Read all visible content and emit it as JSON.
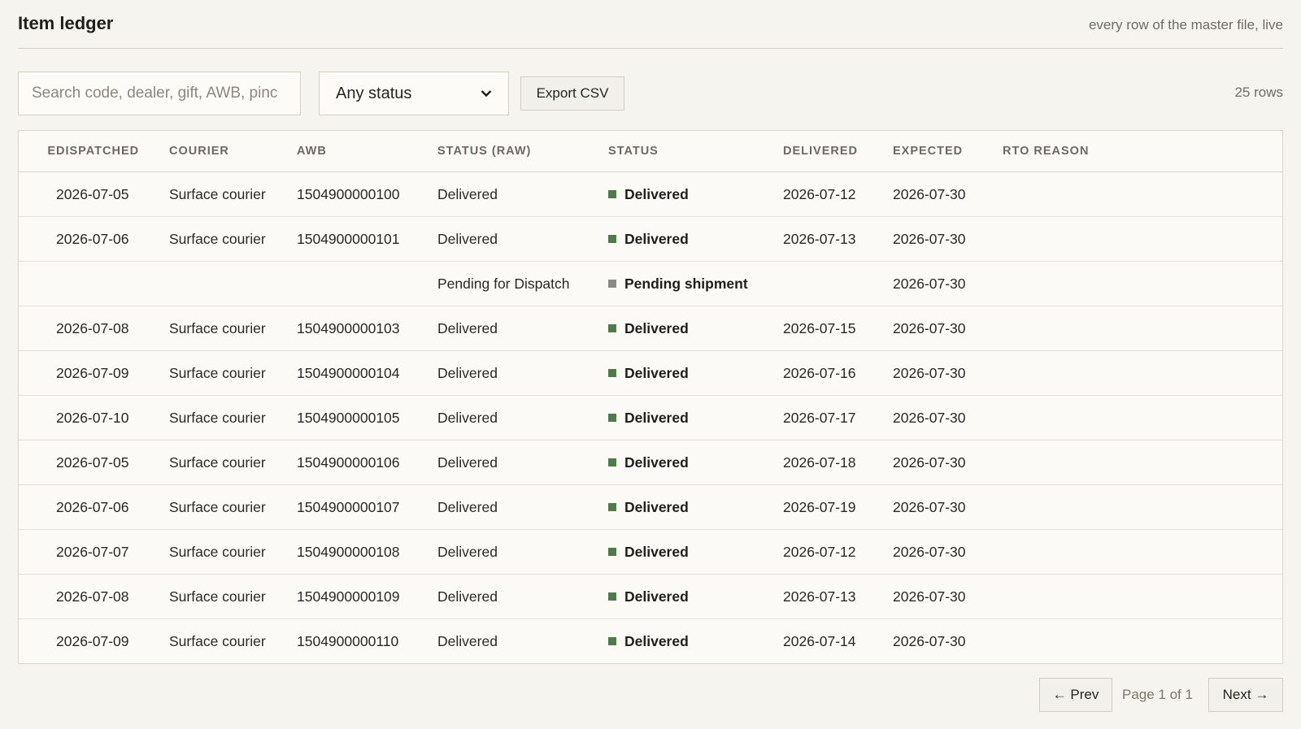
{
  "header": {
    "title": "Item ledger",
    "subtitle": "every row of the master file, live"
  },
  "toolbar": {
    "search_placeholder": "Search code, dealer, gift, AWB, pinc",
    "status_filter": "Any status",
    "export_label": "Export CSV",
    "row_count": "25 rows"
  },
  "table": {
    "columns": [
      "E",
      "DISPATCHED",
      "COURIER",
      "AWB",
      "STATUS (RAW)",
      "STATUS",
      "DELIVERED",
      "EXPECTED",
      "RTO REASON"
    ],
    "rows": [
      {
        "dispatched": "2026-07-05",
        "courier": "Surface courier",
        "awb": "1504900000100",
        "status_raw": "Delivered",
        "status": "Delivered",
        "status_color": "#4f7a4a",
        "delivered": "2026-07-12",
        "expected": "2026-07-30",
        "rto_reason": ""
      },
      {
        "dispatched": "2026-07-06",
        "courier": "Surface courier",
        "awb": "1504900000101",
        "status_raw": "Delivered",
        "status": "Delivered",
        "status_color": "#4f7a4a",
        "delivered": "2026-07-13",
        "expected": "2026-07-30",
        "rto_reason": ""
      },
      {
        "dispatched": "",
        "courier": "",
        "awb": "",
        "status_raw": "Pending for Dispatch",
        "status": "Pending shipment",
        "status_color": "#8c8a85",
        "delivered": "",
        "expected": "2026-07-30",
        "rto_reason": ""
      },
      {
        "dispatched": "2026-07-08",
        "courier": "Surface courier",
        "awb": "1504900000103",
        "status_raw": "Delivered",
        "status": "Delivered",
        "status_color": "#4f7a4a",
        "delivered": "2026-07-15",
        "expected": "2026-07-30",
        "rto_reason": ""
      },
      {
        "dispatched": "2026-07-09",
        "courier": "Surface courier",
        "awb": "1504900000104",
        "status_raw": "Delivered",
        "status": "Delivered",
        "status_color": "#4f7a4a",
        "delivered": "2026-07-16",
        "expected": "2026-07-30",
        "rto_reason": ""
      },
      {
        "dispatched": "2026-07-10",
        "courier": "Surface courier",
        "awb": "1504900000105",
        "status_raw": "Delivered",
        "status": "Delivered",
        "status_color": "#4f7a4a",
        "delivered": "2026-07-17",
        "expected": "2026-07-30",
        "rto_reason": ""
      },
      {
        "dispatched": "2026-07-05",
        "courier": "Surface courier",
        "awb": "1504900000106",
        "status_raw": "Delivered",
        "status": "Delivered",
        "status_color": "#4f7a4a",
        "delivered": "2026-07-18",
        "expected": "2026-07-30",
        "rto_reason": ""
      },
      {
        "dispatched": "2026-07-06",
        "courier": "Surface courier",
        "awb": "1504900000107",
        "status_raw": "Delivered",
        "status": "Delivered",
        "status_color": "#4f7a4a",
        "delivered": "2026-07-19",
        "expected": "2026-07-30",
        "rto_reason": ""
      },
      {
        "dispatched": "2026-07-07",
        "courier": "Surface courier",
        "awb": "1504900000108",
        "status_raw": "Delivered",
        "status": "Delivered",
        "status_color": "#4f7a4a",
        "delivered": "2026-07-12",
        "expected": "2026-07-30",
        "rto_reason": ""
      },
      {
        "dispatched": "2026-07-08",
        "courier": "Surface courier",
        "awb": "1504900000109",
        "status_raw": "Delivered",
        "status": "Delivered",
        "status_color": "#4f7a4a",
        "delivered": "2026-07-13",
        "expected": "2026-07-30",
        "rto_reason": ""
      },
      {
        "dispatched": "2026-07-09",
        "courier": "Surface courier",
        "awb": "1504900000110",
        "status_raw": "Delivered",
        "status": "Delivered",
        "status_color": "#4f7a4a",
        "delivered": "2026-07-14",
        "expected": "2026-07-30",
        "rto_reason": ""
      }
    ]
  },
  "pager": {
    "prev_label": "← Prev",
    "page_info": "Page 1 of 1",
    "next_label": "Next →"
  }
}
